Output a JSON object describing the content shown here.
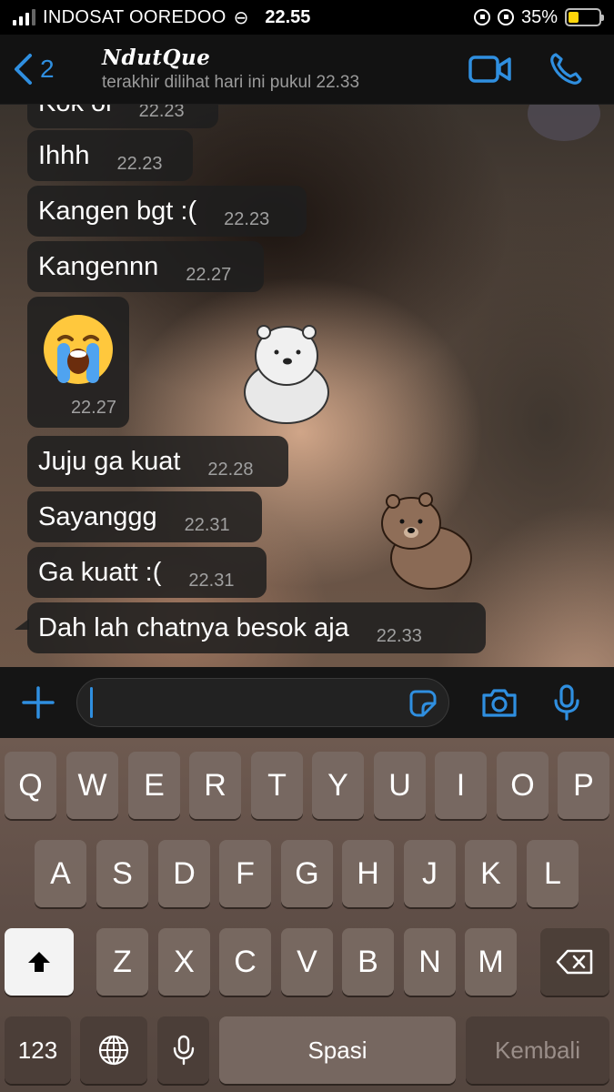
{
  "status_bar": {
    "carrier": "INDOSAT OOREDOO",
    "link_glyph": "⊖",
    "time": "22.55",
    "battery": "35%",
    "battery_level": 0.35,
    "battery_color": "#ffd60a"
  },
  "header": {
    "back_count": "2",
    "contact_name": "NdutQue",
    "last_seen": "terakhir dilihat hari ini pukul 22.33",
    "accent_color": "#2f8fe0",
    "icons": [
      "chevron-left-icon",
      "video-call-icon",
      "phone-icon"
    ]
  },
  "messages": [
    {
      "text": "Kok ol",
      "time": "22.23"
    },
    {
      "text": "Ihhh",
      "time": "22.23"
    },
    {
      "text": "Kangen bgt :(",
      "time": "22.23"
    },
    {
      "text": "Kangennn",
      "time": "22.27"
    },
    {
      "text": "😭",
      "time": "22.27",
      "type": "emoji"
    },
    {
      "text": "Juju ga kuat",
      "time": "22.28"
    },
    {
      "text": "Sayanggg",
      "time": "22.31"
    },
    {
      "text": "Ga kuatt :(",
      "time": "22.31"
    },
    {
      "text": "Dah lah chatnya besok aja",
      "time": "22.33"
    }
  ],
  "input_bar": {
    "placeholder": "",
    "icons": [
      "plus-icon",
      "sticker-icon",
      "camera-icon",
      "microphone-icon"
    ]
  },
  "keyboard": {
    "row1": [
      "Q",
      "W",
      "E",
      "R",
      "T",
      "Y",
      "U",
      "I",
      "O",
      "P"
    ],
    "row2": [
      "A",
      "S",
      "D",
      "F",
      "G",
      "H",
      "J",
      "K",
      "L"
    ],
    "row3": [
      "Z",
      "X",
      "C",
      "V",
      "B",
      "N",
      "M"
    ],
    "numbers_label": "123",
    "space_label": "Spasi",
    "return_label": "Kembali",
    "icons": [
      "shift-icon",
      "backspace-icon",
      "globe-icon",
      "dictation-mic-icon"
    ]
  }
}
